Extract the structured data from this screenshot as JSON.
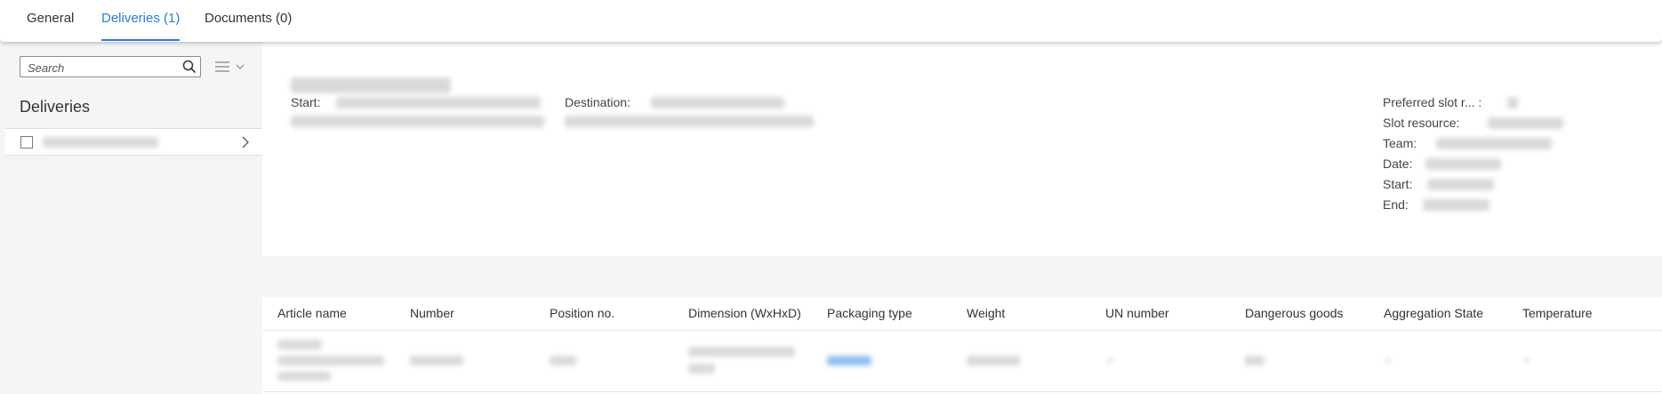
{
  "tabs": [
    {
      "label": "General"
    },
    {
      "label": "Deliveries (1)"
    },
    {
      "label": "Documents (0)"
    }
  ],
  "active_tab": 1,
  "sidebar": {
    "search_placeholder": "Search",
    "title": "Deliveries"
  },
  "details": {
    "start_label": "Start:",
    "destination_label": "Destination:",
    "right_labels": {
      "preferred_slot": "Preferred slot r... :",
      "slot_resource": "Slot resource:",
      "team": "Team:",
      "date": "Date:",
      "start": "Start:",
      "end": "End:"
    }
  },
  "table": {
    "columns": [
      "Article name",
      "Number",
      "Position no.",
      "Dimension (WxHxD)",
      "Packaging type",
      "Weight",
      "UN number",
      "Dangerous goods",
      "Aggregation State",
      "Temperature"
    ]
  },
  "colors": {
    "accent": "#2a7fd4",
    "background": "#f5f5f3",
    "panel": "#ffffff"
  },
  "icons": {
    "search": "search-icon",
    "list_menu": "list-menu-icon",
    "chevron": "chevron-right-icon",
    "checkbox": "checkbox-icon"
  }
}
